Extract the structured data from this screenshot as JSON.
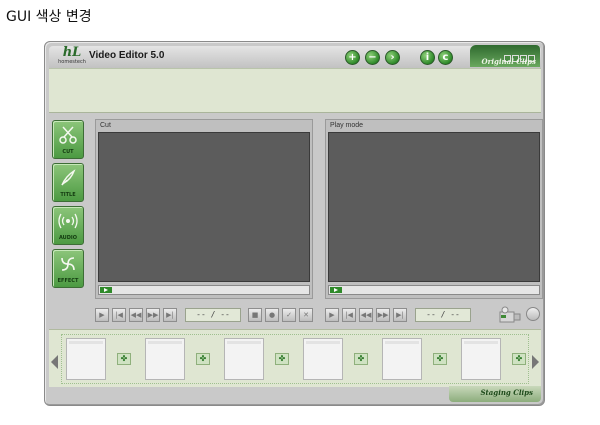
{
  "page": {
    "heading": "GUI 색상 변경"
  },
  "app": {
    "title": "Video Editor 5.0",
    "logo_mark": "hL",
    "logo_text": "homestech",
    "accent_color": "#3f8a36",
    "toolbar_icons": [
      {
        "name": "add-icon",
        "glyph": "+"
      },
      {
        "name": "remove-icon",
        "glyph": "−"
      },
      {
        "name": "next-icon",
        "glyph": "›"
      },
      {
        "name": "info-icon",
        "glyph": "i"
      },
      {
        "name": "settings-icon",
        "glyph": "c"
      }
    ],
    "original_clips_label": "Original Clips",
    "staging_clips_label": "Staging Clips"
  },
  "tools": [
    {
      "name": "cut",
      "label": "CUT",
      "icon": "scissors-icon"
    },
    {
      "name": "title",
      "label": "TITLE",
      "icon": "quill-icon"
    },
    {
      "name": "audio",
      "label": "AUDIO",
      "icon": "audio-wave-icon"
    },
    {
      "name": "effect",
      "label": "EFFECT",
      "icon": "swirl-icon"
    }
  ],
  "panels": {
    "cut": {
      "title": "Cut",
      "time": "-- / --"
    },
    "play": {
      "title": "Play mode",
      "time": "-- / --"
    }
  },
  "transport_icons": [
    "play-icon",
    "skip-start-icon",
    "rewind-icon",
    "forward-icon",
    "skip-end-icon"
  ],
  "transport_glyphs": [
    "▶",
    "|◀",
    "◀◀",
    "▶▶",
    "▶|"
  ],
  "middle_icons": [
    "stop-icon",
    "record-icon",
    "check-icon",
    "close-icon"
  ],
  "middle_glyphs": [
    "■",
    "●",
    "✓",
    "✕"
  ],
  "staging": {
    "frame_count": 6,
    "transition_glyph": "✤"
  }
}
